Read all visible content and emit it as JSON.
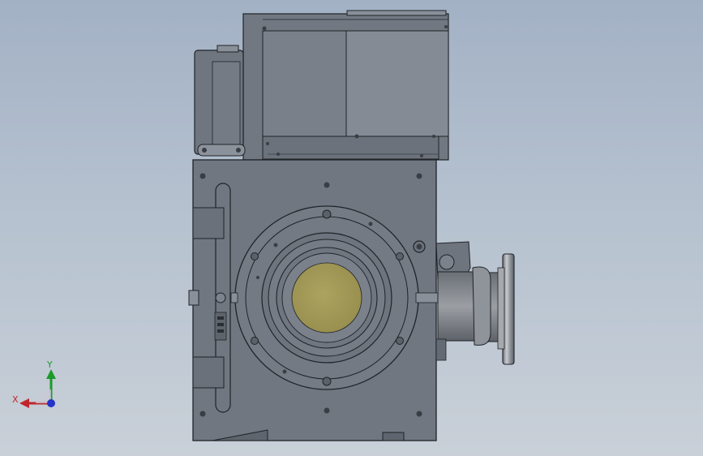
{
  "viewport": {
    "background_top": "#a3b1c5",
    "background_bottom": "#c9d0d8"
  },
  "model": {
    "body_color": "#707781",
    "motor_color": "#7a808a",
    "lens_color": "#a39a57",
    "flange_color": "#9fa3a8"
  },
  "triad": {
    "x_label": "X",
    "y_label": "Y",
    "x_color": "#c0262c",
    "y_color": "#1a9a2a",
    "z_color": "#2433c8"
  }
}
